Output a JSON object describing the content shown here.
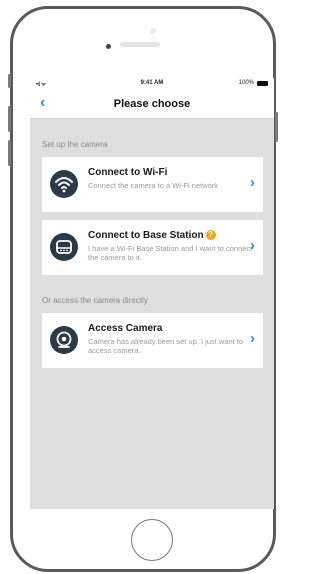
{
  "status_bar": {
    "signal": "•ıl ᯤ",
    "time": "9:41 AM",
    "battery": "100%"
  },
  "nav": {
    "back_glyph": "‹",
    "title": "Please choose"
  },
  "sections": {
    "setup_label": "Set up the camera",
    "direct_label": "Or access the camera directly"
  },
  "options": [
    {
      "title": "Connect to Wi-Fi",
      "description": "Connect the camera to a Wi-Fi network",
      "icon": "wifi-icon"
    },
    {
      "title": "Connect to Base Station",
      "description": "I have a Wi-Fi Base Station and I want to connect the camera to it.",
      "icon": "base-station-icon",
      "help_glyph": "?"
    },
    {
      "title": "Access Camera",
      "description": "Camera has already been set up. I just want to access camera.",
      "icon": "camera-icon"
    }
  ],
  "chevron_glyph": "›",
  "colors": {
    "accent": "#2a8fd8",
    "icon_bg": "#2c3a45",
    "screen_bg": "#dedede",
    "help_badge": "#f0a020"
  }
}
